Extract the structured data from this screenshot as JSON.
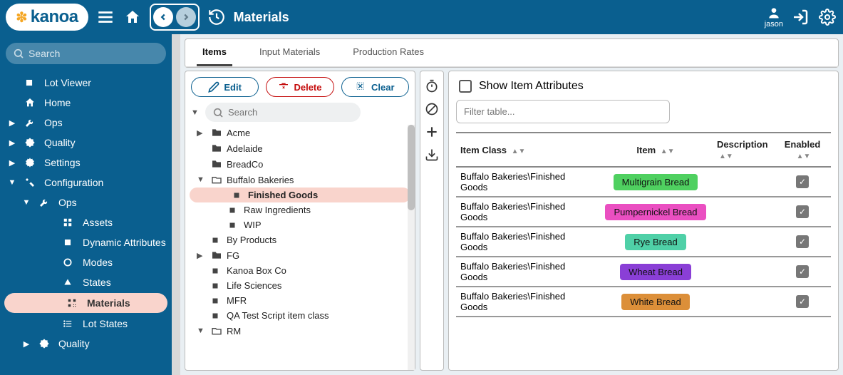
{
  "header": {
    "logo_text": "kanoa",
    "page_title": "Materials",
    "user": "jason"
  },
  "sidebar": {
    "search_placeholder": "Search",
    "items": [
      {
        "depth": 1,
        "label": "Lot Viewer",
        "icon": "square",
        "caret": ""
      },
      {
        "depth": 1,
        "label": "Home",
        "icon": "home",
        "caret": ""
      },
      {
        "depth": 1,
        "label": "Ops",
        "icon": "wrench",
        "caret": "▶"
      },
      {
        "depth": 1,
        "label": "Quality",
        "icon": "badge",
        "caret": "▶"
      },
      {
        "depth": 1,
        "label": "Settings",
        "icon": "gear",
        "caret": "▶"
      },
      {
        "depth": 1,
        "label": "Configuration",
        "icon": "tool",
        "caret": "▼"
      },
      {
        "depth": 2,
        "label": "Ops",
        "icon": "wrench",
        "caret": "▼"
      },
      {
        "depth": 3,
        "label": "Assets",
        "icon": "grid",
        "caret": ""
      },
      {
        "depth": 3,
        "label": "Dynamic Attributes",
        "icon": "square",
        "caret": ""
      },
      {
        "depth": 3,
        "label": "Modes",
        "icon": "circle",
        "caret": ""
      },
      {
        "depth": 3,
        "label": "States",
        "icon": "tri",
        "caret": ""
      },
      {
        "depth": 3,
        "label": "Materials",
        "icon": "qr",
        "caret": "",
        "selected": true
      },
      {
        "depth": 3,
        "label": "Lot States",
        "icon": "list",
        "caret": ""
      },
      {
        "depth": 2,
        "label": "Quality",
        "icon": "badge",
        "caret": "▶"
      }
    ]
  },
  "tabs": [
    {
      "label": "Items",
      "active": true
    },
    {
      "label": "Input Materials",
      "active": false
    },
    {
      "label": "Production Rates",
      "active": false
    }
  ],
  "left_panel": {
    "buttons": {
      "edit": "Edit",
      "delete": "Delete",
      "clear": "Clear"
    },
    "tree_search_placeholder": "Search",
    "tree": [
      {
        "depth": 0,
        "label": "Acme",
        "icon": "folder",
        "caret": "▶"
      },
      {
        "depth": 0,
        "label": "Adelaide",
        "icon": "folder",
        "caret": ""
      },
      {
        "depth": 0,
        "label": "BreadCo",
        "icon": "folder",
        "caret": ""
      },
      {
        "depth": 0,
        "label": "Buffalo Bakeries",
        "icon": "folder-open",
        "caret": "▼"
      },
      {
        "depth": 1,
        "label": "Finished Goods",
        "icon": "square",
        "caret": "",
        "selected": true
      },
      {
        "depth": 1,
        "label": "Raw Ingredients",
        "icon": "square",
        "caret": ""
      },
      {
        "depth": 1,
        "label": "WIP",
        "icon": "square",
        "caret": ""
      },
      {
        "depth": 0,
        "label": "By Products",
        "icon": "square",
        "caret": ""
      },
      {
        "depth": 0,
        "label": "FG",
        "icon": "folder",
        "caret": "▶"
      },
      {
        "depth": 0,
        "label": "Kanoa Box Co",
        "icon": "square",
        "caret": ""
      },
      {
        "depth": 0,
        "label": "Life Sciences",
        "icon": "square",
        "caret": ""
      },
      {
        "depth": 0,
        "label": "MFR",
        "icon": "square",
        "caret": ""
      },
      {
        "depth": 0,
        "label": "QA Test Script item class",
        "icon": "square",
        "caret": ""
      },
      {
        "depth": 0,
        "label": "RM",
        "icon": "folder-open",
        "caret": "▼"
      }
    ]
  },
  "right_panel": {
    "show_attributes_label": "Show Item Attributes",
    "filter_placeholder": "Filter table...",
    "columns": [
      "Item Class",
      "Item",
      "Description",
      "Enabled"
    ],
    "rows": [
      {
        "class": "Buffalo Bakeries\\Finished Goods",
        "item": "Multigrain Bread",
        "color": "#4fd060",
        "desc": "",
        "enabled": true
      },
      {
        "class": "Buffalo Bakeries\\Finished Goods",
        "item": "Pumpernickel Bread",
        "color": "#ea4fc1",
        "desc": "",
        "enabled": true
      },
      {
        "class": "Buffalo Bakeries\\Finished Goods",
        "item": "Rye Bread",
        "color": "#4fd0a7",
        "desc": "",
        "enabled": true
      },
      {
        "class": "Buffalo Bakeries\\Finished Goods",
        "item": "Wheat Bread",
        "color": "#8a3fd6",
        "desc": "",
        "enabled": true
      },
      {
        "class": "Buffalo Bakeries\\Finished Goods",
        "item": "White Bread",
        "color": "#dc8f39",
        "desc": "",
        "enabled": true
      }
    ]
  }
}
